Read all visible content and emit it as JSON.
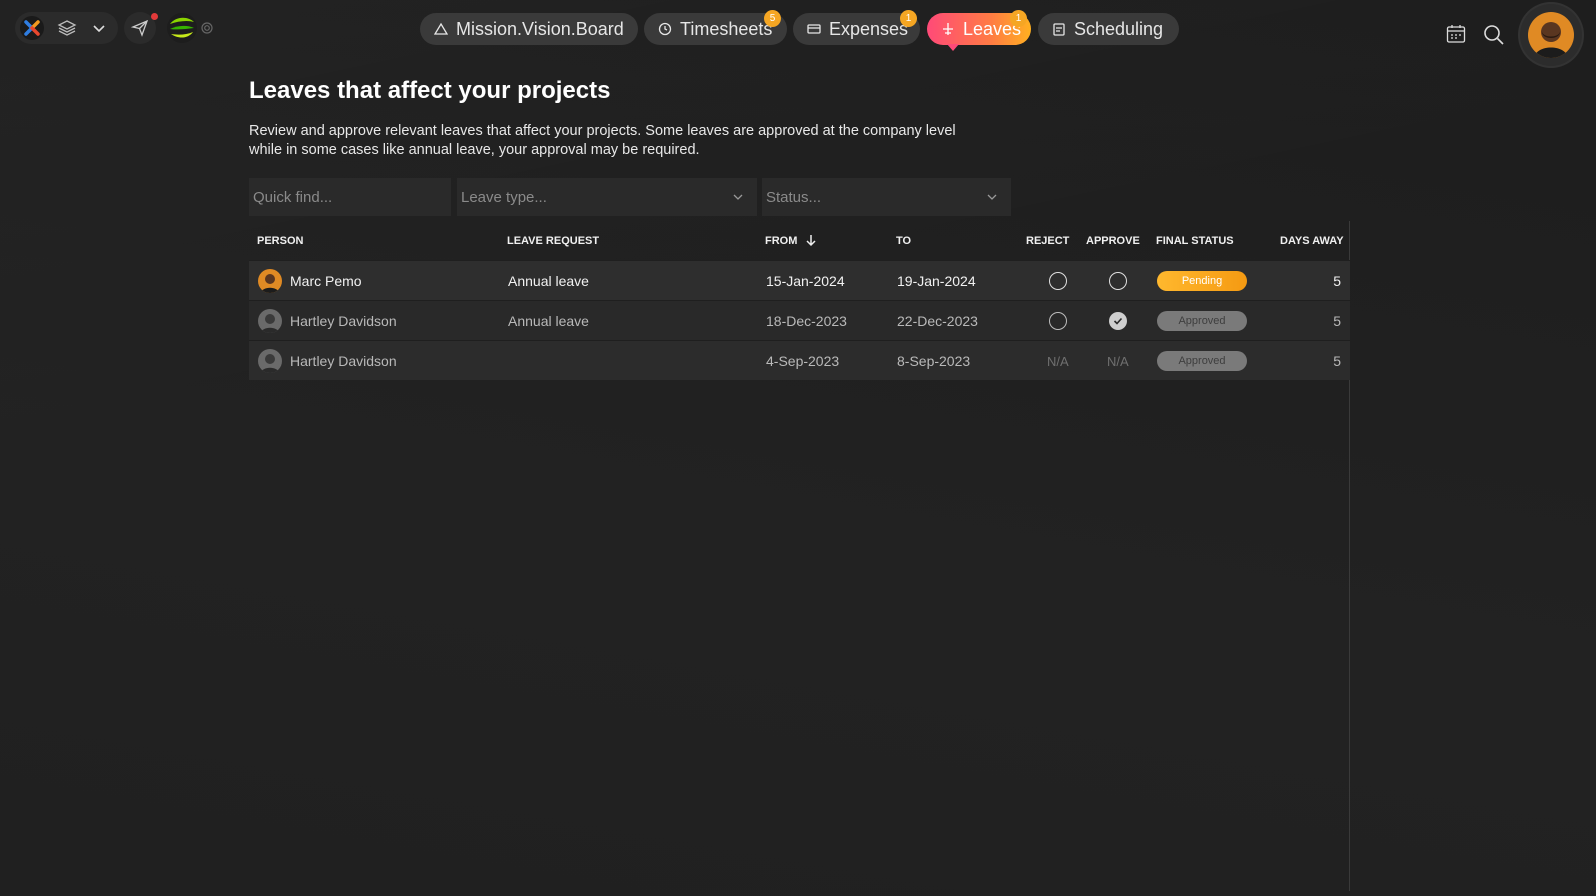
{
  "nav": {
    "tabs": [
      {
        "label": "Mission.Vision.Board",
        "badge": null,
        "active": false
      },
      {
        "label": "Timesheets",
        "badge": "5",
        "active": false
      },
      {
        "label": "Expenses",
        "badge": "1",
        "active": false
      },
      {
        "label": "Leaves",
        "badge": "1",
        "active": true
      },
      {
        "label": "Scheduling",
        "badge": null,
        "active": false
      }
    ]
  },
  "page": {
    "title": "Leaves that affect your projects",
    "description": "Review and approve relevant leaves that affect your projects. Some leaves are approved at the company level while in some cases like annual leave, your approval may be required."
  },
  "filters": {
    "quick_find_placeholder": "Quick find...",
    "leave_type_placeholder": "Leave type...",
    "status_placeholder": "Status..."
  },
  "table": {
    "headers": {
      "person": "PERSON",
      "leave_request": "LEAVE REQUEST",
      "from": "FROM",
      "to": "TO",
      "reject": "REJECT",
      "approve": "APPROVE",
      "final_status": "FINAL STATUS",
      "days_away": "DAYS AWAY"
    },
    "rows": [
      {
        "person": "Marc Pemo",
        "leave_request": "Annual leave",
        "from": "15-Jan-2024",
        "to": "19-Jan-2024",
        "reject": "radio",
        "approve": "radio",
        "final_status": "Pending",
        "days_away": "5"
      },
      {
        "person": "Hartley Davidson",
        "leave_request": "Annual leave",
        "from": "18-Dec-2023",
        "to": "22-Dec-2023",
        "reject": "radio",
        "approve": "checked",
        "final_status": "Approved",
        "days_away": "5"
      },
      {
        "person": "Hartley Davidson",
        "leave_request": "",
        "from": "4-Sep-2023",
        "to": "8-Sep-2023",
        "reject": "N/A",
        "approve": "N/A",
        "final_status": "Approved",
        "days_away": "5"
      }
    ]
  },
  "colors": {
    "active_tab_gradient_start": "#ff4a78",
    "active_tab_gradient_end": "#ffb020",
    "badge": "#f5a623",
    "pending": "#ffb82e",
    "approved": "#7a7a7a"
  },
  "icons": [
    "logo-icon",
    "layers-icon",
    "chevron-down-icon",
    "send-icon",
    "brand-icon",
    "gear-icon",
    "calendar-icon",
    "search-icon",
    "sort-down-icon"
  ]
}
